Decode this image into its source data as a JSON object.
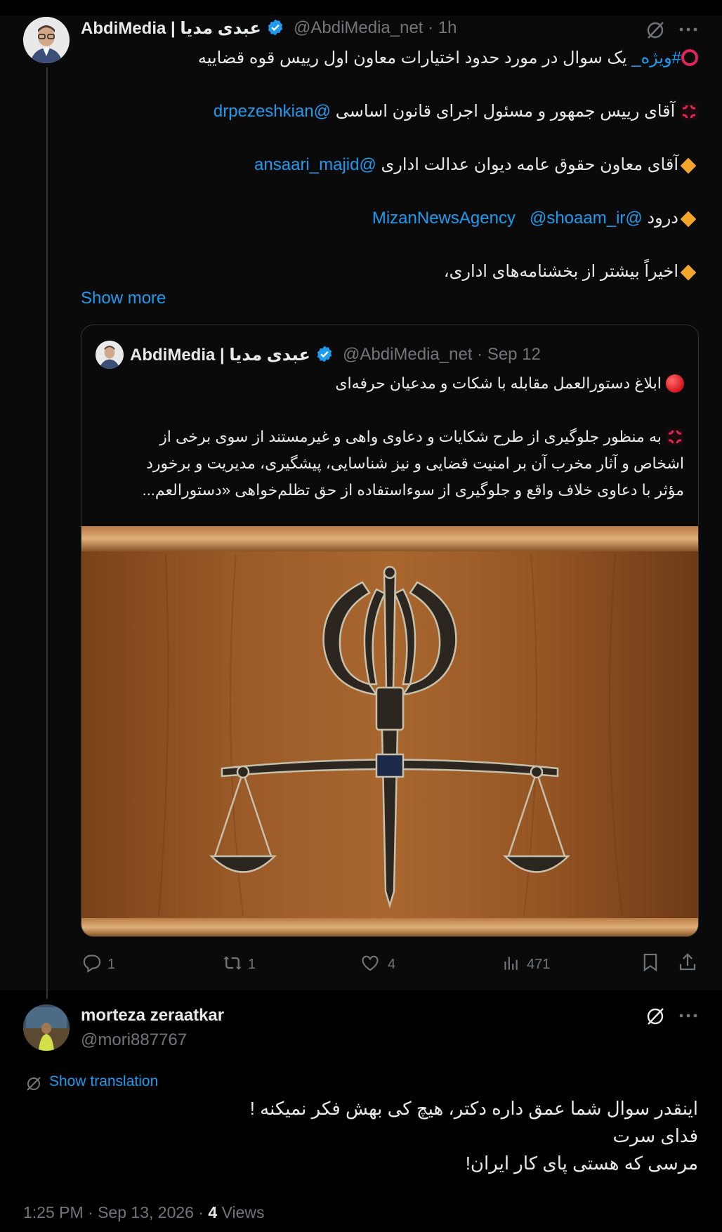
{
  "post": {
    "author_name": "AbdiMedia | عبدی مدیا",
    "author_handle": "@AbdiMedia_net",
    "time": "· 1h",
    "lines": {
      "l1_tag": "#ویژه_",
      "l1_text": "  یک سوال در مورد حدود اختیارات معاون اول رییس قوه قضاییه",
      "l2_text": "آقای رییس جمهور و مسئول اجرای قانون اساسی ",
      "l2_mention": "@drpezeshkian",
      "l3_text": "آقای معاون حقوق عامه دیوان عدالت اداری ",
      "l3_mention": "@ansaari_majid",
      "l4_text": "درود ",
      "l4_mention1": "@MizanNewsAgency",
      "l4_mention2": "@shoaam_ir",
      "l5_text": "اخیراً بیشتر از بخشنامه‌های اداری،"
    },
    "show_more": "Show more",
    "quote": {
      "author_name": "AbdiMedia | عبدی مدیا",
      "author_handle": "@AbdiMedia_net",
      "time": "· Sep 12",
      "q1": "ابلاغ دستورالعمل مقابله با شکات و مدعیان حرفه‌ای",
      "q2": "به منظور جلوگیری از طرح شکایات و دعاوی واهی و غیرمستند از سوی برخی از",
      "q3": "اشخاص و آثار مخرب آن بر امنیت قضایی و نیز شناسایی، پیشگیری، مدیریت و برخورد",
      "q4": "مؤثر با دعاوی خلاف واقع و جلوگیری از سوءاستفاده از حق تظلم‌خواهی «دستورالعم..."
    },
    "actions": {
      "replies": "1",
      "reposts": "1",
      "likes": "4",
      "views": "471"
    }
  },
  "reply": {
    "author_name": "morteza zeraatkar",
    "author_handle": "@mori887767",
    "show_translation": "Show translation",
    "text1": "اینقدر سوال شما عمق داره دکتر، هیچ کی بهش فکر نمیکنه !",
    "text2": "فدای سرت",
    "text3": "مرسی که هستی پای کار ایران!",
    "timestamp": "1:25 PM · Sep 13, 2026 · ",
    "views_count": "4",
    "views_label": " Views"
  },
  "colors": {
    "accent": "#1d9bf0",
    "muted": "#71767b",
    "background": "#000000"
  }
}
